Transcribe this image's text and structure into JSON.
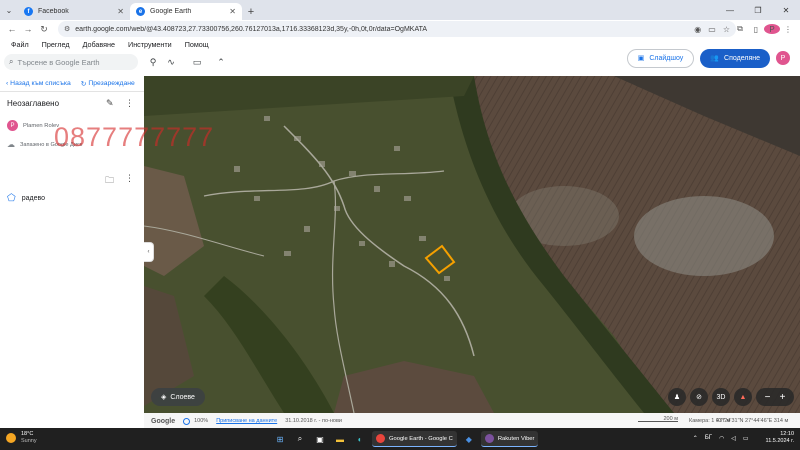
{
  "browser": {
    "tabs": [
      {
        "title": "Facebook",
        "active": false,
        "favicon_color": "#1877f2",
        "favicon_letter": "f"
      },
      {
        "title": "Google Earth",
        "active": true,
        "favicon_color": "#1a73e8",
        "favicon_letter": "e"
      }
    ],
    "url": "earth.google.com/web/@43.408723,27.73300756,260.76127013a,1716.33368123d,35y,-0h,0t,0r/data=OgMKATA",
    "profile_letter": "P"
  },
  "app": {
    "menu": [
      "Файл",
      "Преглед",
      "Добавяне",
      "Инструменти",
      "Помощ"
    ],
    "search_placeholder": "Търсене в Google Earth",
    "slideshow_label": "Слайдшоу",
    "share_label": "Споделяне",
    "profile_letter": "P"
  },
  "panel": {
    "back_label": "Назад към списъка",
    "reload_label": "Презареждане",
    "project_title": "Неозаглавено",
    "owner_letter": "P",
    "owner_name": "Plamen Rolev",
    "saved_text": "Запазено в Google Диск",
    "item_name": "радево",
    "watermark": "0877777777"
  },
  "map": {
    "layers_label": "Слоеве",
    "btn_3d": "3D",
    "zoom_minus": "−",
    "zoom_plus": "+"
  },
  "status": {
    "google": "Google",
    "percent": "100%",
    "attribution": "Приписване на данните",
    "date": "31.10.2018 г. - по-нови",
    "scale": "200 м",
    "camera": "Камера: 1 977 м",
    "coords": "43°24'31\"N 27°44'46\"E  314 м"
  },
  "taskbar": {
    "temp": "18°C",
    "weather": "Sunny",
    "app1": "Google Earth - Google C",
    "app2": "Rakuten Viber",
    "lang": "БГ",
    "time": "12:10",
    "date": "11.5.2024 г."
  }
}
